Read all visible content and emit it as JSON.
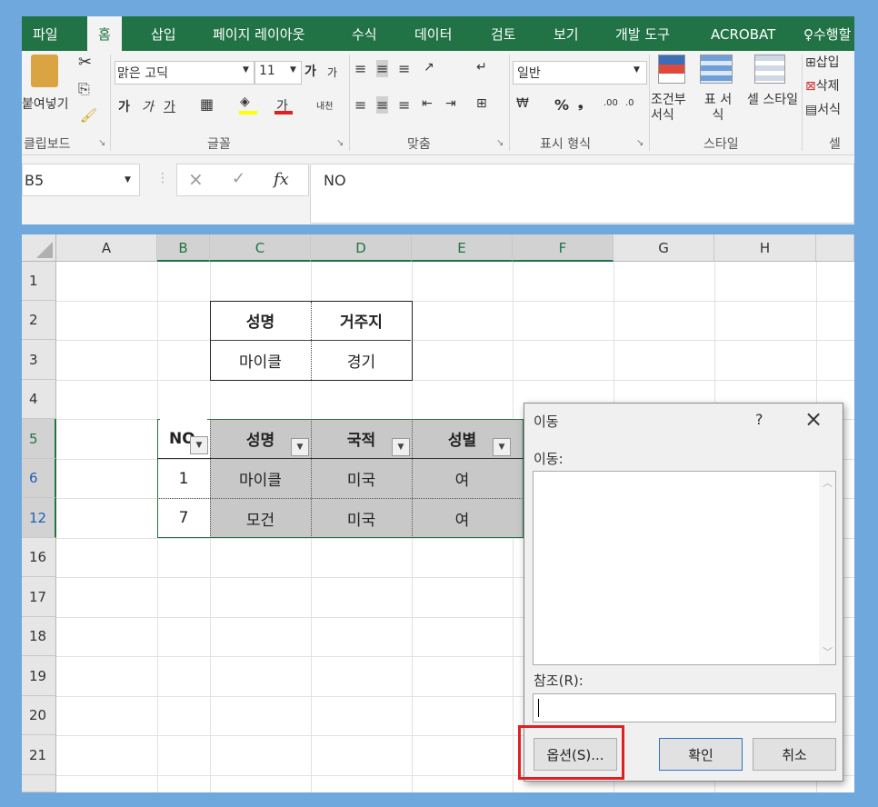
{
  "ribbon": {
    "tabs": [
      "파일",
      "홈",
      "삽입",
      "페이지 레이아웃",
      "수식",
      "데이터",
      "검토",
      "보기",
      "개발 도구",
      "ACROBAT",
      "수행할"
    ],
    "clipboard": {
      "paste": "붙여넣기",
      "group": "클립보드"
    },
    "font": {
      "name": "맑은 고딕",
      "size": "11",
      "grow": "가",
      "shrink": "가",
      "bold": "가",
      "italic": "가",
      "underline": "가",
      "strike_color": "가",
      "phonetic": "내천",
      "group": "글꼴"
    },
    "align": {
      "group": "맞춤"
    },
    "number": {
      "format": "일반",
      "percent": "%",
      "comma": "❟",
      "group": "표시 형식"
    },
    "styles": {
      "cond_format": "조건부 서식",
      "table": "표 서식",
      "cell": "셀 스타일",
      "group": "스타일"
    },
    "cells": {
      "insert": "삽입",
      "delete": "삭제",
      "format": "서식",
      "group": "셀"
    }
  },
  "formula": {
    "name_box": "B5",
    "cancel": "×",
    "enter": "✓",
    "fx": "fx",
    "value": "NO"
  },
  "columns": [
    "A",
    "B",
    "C",
    "D",
    "E",
    "F",
    "G",
    "H"
  ],
  "rows": [
    "1",
    "2",
    "3",
    "4",
    "5",
    "6",
    "12",
    "16",
    "17",
    "18",
    "19",
    "20",
    "21"
  ],
  "criteria": {
    "headers": [
      "성명",
      "거주지"
    ],
    "values": [
      "마이클",
      "경기"
    ]
  },
  "table": {
    "headers": [
      "NO",
      "성명",
      "국적",
      "성별"
    ],
    "rows": [
      [
        "1",
        "마이클",
        "미국",
        "여"
      ],
      [
        "7",
        "모건",
        "미국",
        "여"
      ]
    ]
  },
  "dialog": {
    "title": "이동",
    "help": "?",
    "close": "×",
    "goto_label": "이동:",
    "ref_label": "참조(R):",
    "ref_value": "",
    "options": "옵션(S)...",
    "ok": "확인",
    "cancel": "취소"
  },
  "colors": {
    "excel_green": "#217346",
    "highlight_red": "#e02020",
    "frame": "#6fa8dc"
  }
}
